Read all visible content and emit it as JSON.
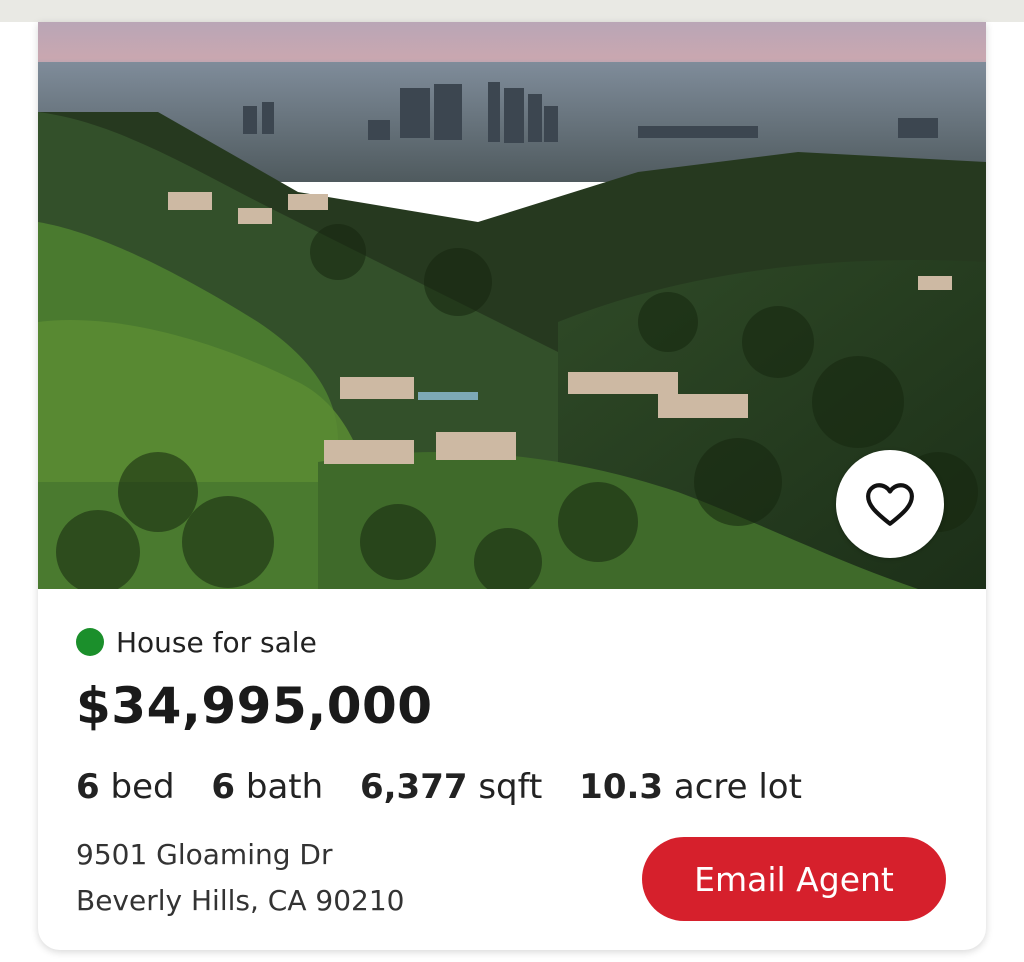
{
  "listing": {
    "favorite_icon": "heart-outline-icon",
    "status_color": "#1b8f2b",
    "status_text": "House for sale",
    "price": "$34,995,000",
    "specs": [
      {
        "value": "6",
        "unit": "bed"
      },
      {
        "value": "6",
        "unit": "bath"
      },
      {
        "value": "6,377",
        "unit": "sqft"
      },
      {
        "value": "10.3",
        "unit": "acre lot"
      }
    ],
    "address_line1": "9501 Gloaming Dr",
    "address_line2": "Beverly Hills, CA 90210",
    "email_button_label": "Email Agent",
    "email_button_color": "#d6202c"
  }
}
